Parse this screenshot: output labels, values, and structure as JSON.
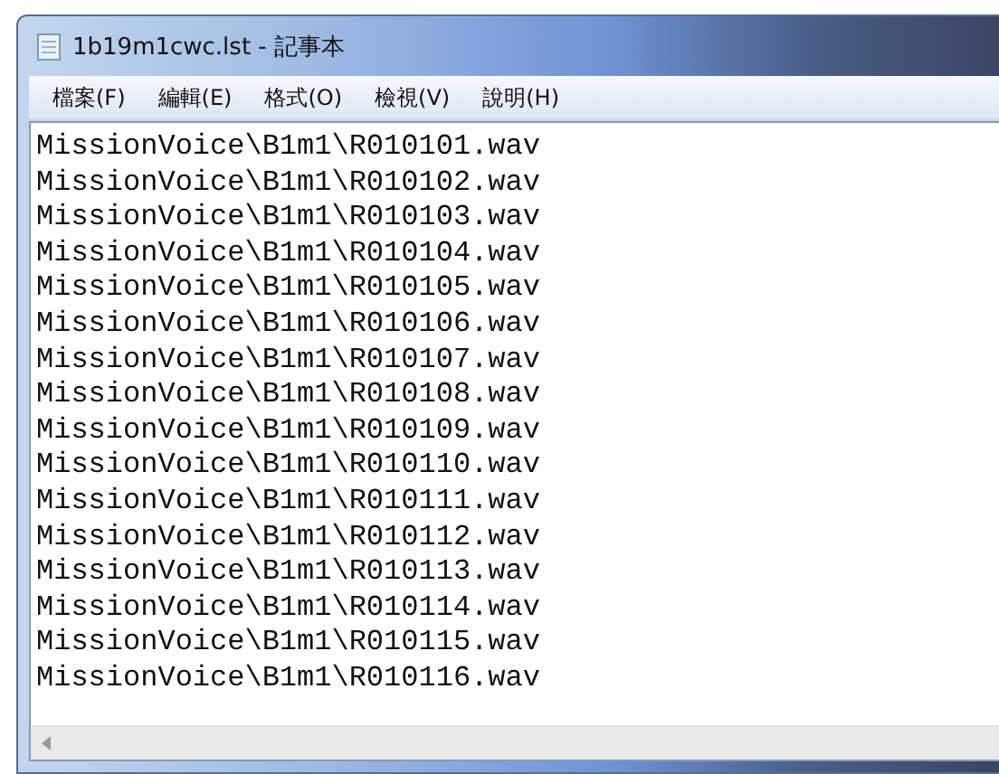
{
  "window": {
    "title": "1b19m1cwc.lst - 記事本"
  },
  "menu": [
    "檔案(F)",
    "編輯(E)",
    "格式(O)",
    "檢視(V)",
    "說明(H)"
  ],
  "lines": [
    "MissionVoice\\B1m1\\R010101.wav",
    "MissionVoice\\B1m1\\R010102.wav",
    "MissionVoice\\B1m1\\R010103.wav",
    "MissionVoice\\B1m1\\R010104.wav",
    "MissionVoice\\B1m1\\R010105.wav",
    "MissionVoice\\B1m1\\R010106.wav",
    "MissionVoice\\B1m1\\R010107.wav",
    "MissionVoice\\B1m1\\R010108.wav",
    "MissionVoice\\B1m1\\R010109.wav",
    "MissionVoice\\B1m1\\R010110.wav",
    "MissionVoice\\B1m1\\R010111.wav",
    "MissionVoice\\B1m1\\R010112.wav",
    "MissionVoice\\B1m1\\R010113.wav",
    "MissionVoice\\B1m1\\R010114.wav",
    "MissionVoice\\B1m1\\R010115.wav",
    "MissionVoice\\B1m1\\R010116.wav"
  ]
}
